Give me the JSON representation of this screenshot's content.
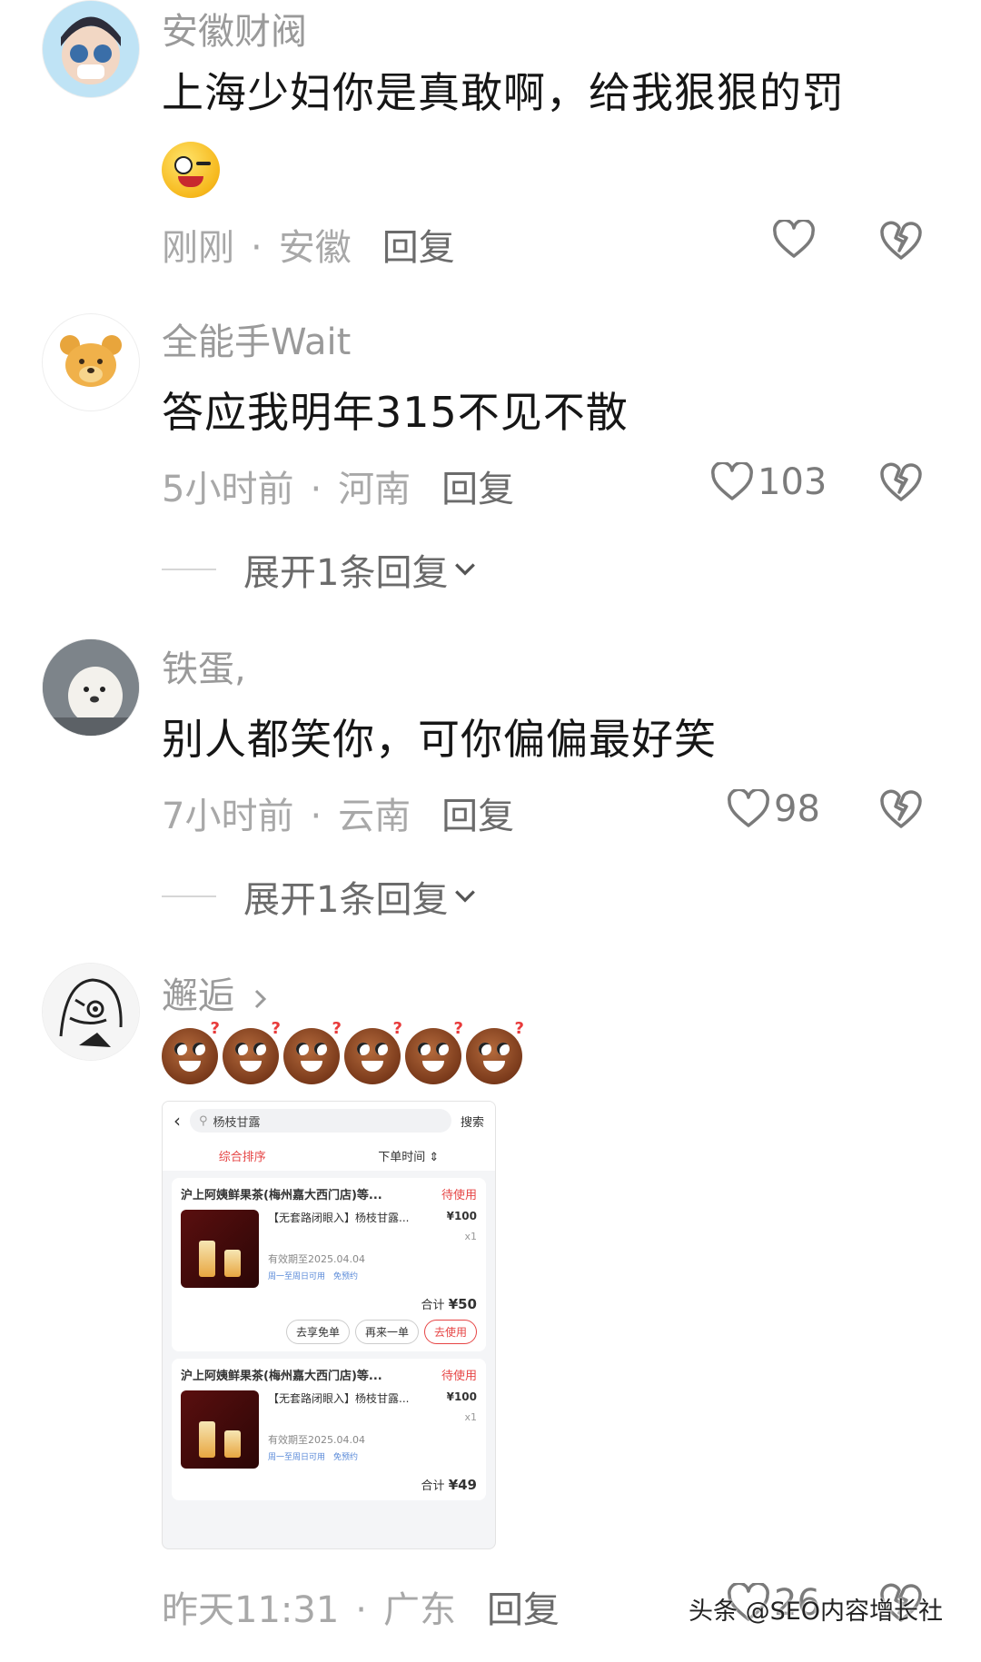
{
  "comments": [
    {
      "username": "安徽财阀",
      "text": "上海少妇你是真敢啊，给我狠狠的罚",
      "time": "刚刚",
      "location": "安徽",
      "reply_label": "回复",
      "likes": ""
    },
    {
      "username": "全能手Wait",
      "text": "答应我明年315不见不散",
      "time": "5小时前",
      "location": "河南",
      "reply_label": "回复",
      "likes": "103",
      "expand_label": "展开1条回复"
    },
    {
      "username": "铁蛋,",
      "text": "别人都笑你，可你偏偏最好笑",
      "time": "7小时前",
      "location": "云南",
      "reply_label": "回复",
      "likes": "98",
      "expand_label": "展开1条回复"
    },
    {
      "username": "邂逅",
      "time": "昨天11:31",
      "location": "广东",
      "reply_label": "回复",
      "likes": "26"
    }
  ],
  "separator": "·",
  "order_screenshot": {
    "search_text": "杨枝甘露",
    "search_button": "搜索",
    "sort_left": "综合排序",
    "sort_right": "下单时间",
    "orders": [
      {
        "store": "沪上阿姨鲜果茶(梅州嘉大西门店)等...",
        "status": "待使用",
        "product": "【无套路闭眼入】杨枝甘露...",
        "price": "¥100",
        "qty": "x1",
        "valid": "有效期至2025.04.04",
        "avail": "周一至周日可用　免预约",
        "total_label": "合计",
        "total": "¥50",
        "buttons": [
          "去享免单",
          "再来一单",
          "去使用"
        ]
      },
      {
        "store": "沪上阿姨鲜果茶(梅州嘉大西门店)等...",
        "status": "待使用",
        "product": "【无套路闭眼入】杨枝甘露...",
        "price": "¥100",
        "qty": "x1",
        "valid": "有效期至2025.04.04",
        "avail": "周一至周日可用　免预约",
        "total_label": "合计",
        "total": "¥49"
      }
    ]
  },
  "watermark": "头条 @SEO内容增长社",
  "colors": {
    "status_red": "#e64545",
    "meta_gray": "#a8a8a8"
  }
}
